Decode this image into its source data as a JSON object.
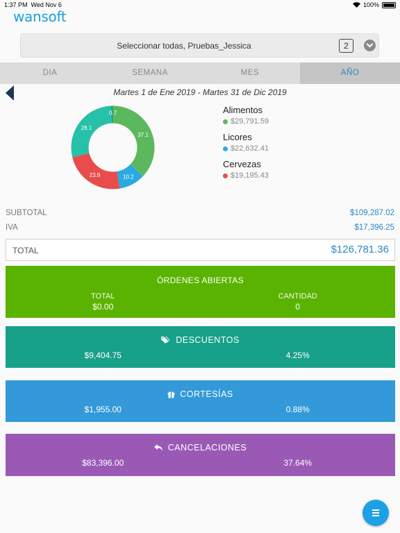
{
  "status": {
    "time": "1:37 PM",
    "date": "Wed Nov 6",
    "battery": "100%"
  },
  "app": {
    "logo": "wansoft"
  },
  "selector": {
    "text": "Seleccionar todas, Pruebas_Jessica",
    "count": "2"
  },
  "tabs": [
    {
      "label": "DIA",
      "active": false
    },
    {
      "label": "SEMANA",
      "active": false
    },
    {
      "label": "MES",
      "active": false
    },
    {
      "label": "AÑO",
      "active": true
    }
  ],
  "date_range": "Martes 1 de Ene 2019  -  Martes 31 de Dic 2019",
  "chart_data": {
    "type": "pie",
    "donut": true,
    "slices": [
      {
        "value": 37.1,
        "color": "#5cb85c"
      },
      {
        "value": 10.2,
        "color": "#29abe2"
      },
      {
        "value": 23.9,
        "color": "#e84c4c"
      },
      {
        "value": 28.1,
        "color": "#27c0a8"
      },
      {
        "value": 0.7,
        "color": "#1a9e7a"
      }
    ]
  },
  "legend": [
    {
      "name": "Alimentos",
      "value": "$29,791.59",
      "color": "#5cb85c"
    },
    {
      "name": "Licores",
      "value": "$22,632.41",
      "color": "#29abe2"
    },
    {
      "name": "Cervezas",
      "value": "$19,195.43",
      "color": "#e84c4c"
    }
  ],
  "totals": {
    "subtotal_label": "SUBTOTAL",
    "subtotal": "$109,287.02",
    "iva_label": "IVA",
    "iva": "$17,396.25",
    "total_label": "TOTAL",
    "total": "$126,781.36"
  },
  "ordenes": {
    "title": "ÓRDENES ABIERTAS",
    "col1_label": "TOTAL",
    "col1_value": "$0.00",
    "col2_label": "CANTIDAD",
    "col2_value": "0"
  },
  "descuentos": {
    "title": "DESCUENTOS",
    "amount": "$9,404.75",
    "percent": "4.25%",
    "icon": "tags-icon"
  },
  "cortesias": {
    "title": "CORTESÍAS",
    "amount": "$1,955.00",
    "percent": "0.88%",
    "icon": "gift-icon"
  },
  "cancelaciones": {
    "title": "CANCELACIONES",
    "amount": "$83,396.00",
    "percent": "37.64%",
    "icon": "undo-icon"
  },
  "fab": {
    "icon": "menu-icon"
  }
}
